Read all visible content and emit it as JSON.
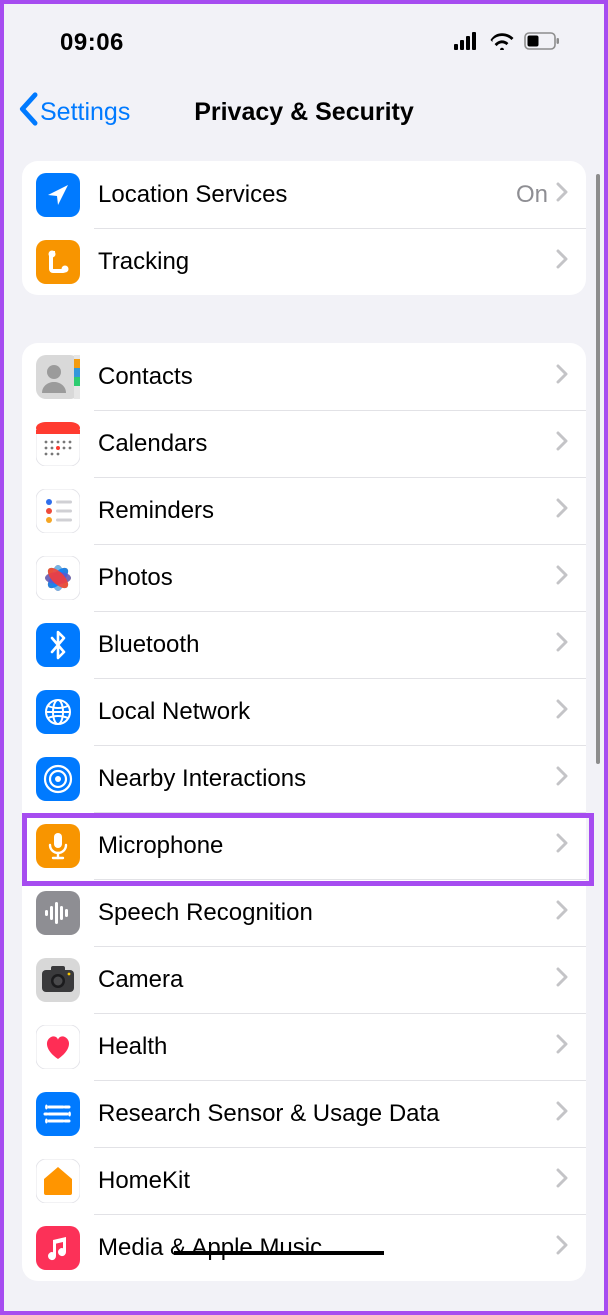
{
  "status": {
    "time": "09:06"
  },
  "nav": {
    "back_label": "Settings",
    "title": "Privacy & Security"
  },
  "group1": {
    "items": [
      {
        "id": "location-services",
        "label": "Location Services",
        "value": "On",
        "icon": "location",
        "bg": "#007aff"
      },
      {
        "id": "tracking",
        "label": "Tracking",
        "value": "",
        "icon": "tracking",
        "bg": "#f89500"
      }
    ]
  },
  "group2": {
    "items": [
      {
        "id": "contacts",
        "label": "Contacts",
        "icon": "contacts",
        "bg": "#bdbdbd"
      },
      {
        "id": "calendars",
        "label": "Calendars",
        "icon": "calendar",
        "bg": "#ffffff"
      },
      {
        "id": "reminders",
        "label": "Reminders",
        "icon": "reminders",
        "bg": "#ffffff"
      },
      {
        "id": "photos",
        "label": "Photos",
        "icon": "photos",
        "bg": "#ffffff"
      },
      {
        "id": "bluetooth",
        "label": "Bluetooth",
        "icon": "bluetooth",
        "bg": "#007aff"
      },
      {
        "id": "local-network",
        "label": "Local Network",
        "icon": "globe",
        "bg": "#007aff"
      },
      {
        "id": "nearby-interactions",
        "label": "Nearby Interactions",
        "icon": "nearby",
        "bg": "#007aff"
      },
      {
        "id": "microphone",
        "label": "Microphone",
        "icon": "mic",
        "bg": "#f89500"
      },
      {
        "id": "speech-recognition",
        "label": "Speech Recognition",
        "icon": "speech",
        "bg": "#8e8e93"
      },
      {
        "id": "camera",
        "label": "Camera",
        "icon": "camera",
        "bg": "#8e8e93"
      },
      {
        "id": "health",
        "label": "Health",
        "icon": "health",
        "bg": "#ffffff"
      },
      {
        "id": "research",
        "label": "Research Sensor & Usage Data",
        "icon": "research",
        "bg": "#007aff"
      },
      {
        "id": "homekit",
        "label": "HomeKit",
        "icon": "home",
        "bg": "#ffffff"
      },
      {
        "id": "media",
        "label": "Media & Apple Music",
        "icon": "music",
        "bg": "#fc3158"
      }
    ]
  },
  "annotations": {
    "highlighted_row": "microphone",
    "strikethrough_row": "media"
  }
}
